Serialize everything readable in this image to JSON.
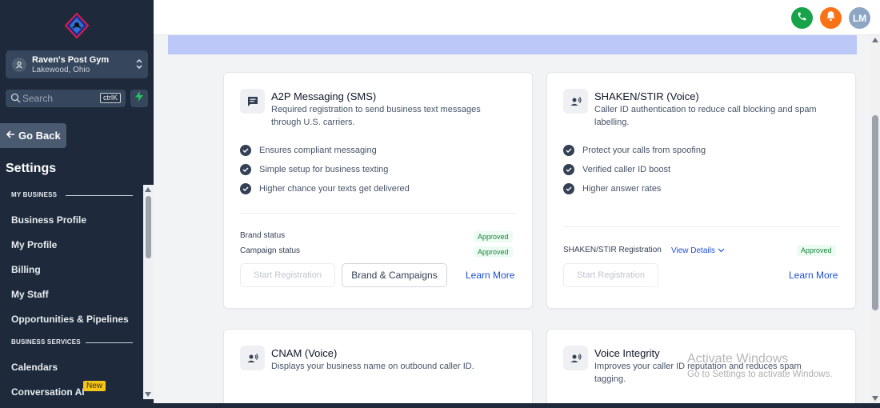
{
  "sidebar": {
    "location": {
      "name": "Raven's Post Gym",
      "sub": "Lakewood, Ohio"
    },
    "search": {
      "placeholder": "Search",
      "shortcut": "ctrlK"
    },
    "go_back": "Go Back",
    "settings_title": "Settings",
    "sections": [
      {
        "label": "MY BUSINESS"
      },
      {
        "label": "BUSINESS SERVICES"
      }
    ],
    "items": [
      {
        "label": "Business Profile"
      },
      {
        "label": "My Profile"
      },
      {
        "label": "Billing"
      },
      {
        "label": "My Staff"
      },
      {
        "label": "Opportunities & Pipelines"
      },
      {
        "label": "Calendars"
      },
      {
        "label": "Conversation AI",
        "badge": "New"
      }
    ]
  },
  "topbar": {
    "avatar_initials": "LM",
    "icons": [
      "phone-icon",
      "bell-icon"
    ]
  },
  "cards": [
    {
      "icon": "message-icon",
      "title": "A2P Messaging (SMS)",
      "description": "Required registration to send business text messages through U.S. carriers.",
      "features": [
        "Ensures compliant messaging",
        "Simple setup for business texting",
        "Higher chance your texts get delivered"
      ],
      "statuses": [
        {
          "label": "Brand status",
          "value": "Approved"
        },
        {
          "label": "Campaign status",
          "value": "Approved"
        }
      ],
      "buttons": {
        "start": "Start Registration",
        "secondary": "Brand & Campaigns",
        "learn": "Learn More"
      }
    },
    {
      "icon": "voice-icon",
      "title": "SHAKEN/STIR (Voice)",
      "description": "Caller ID authentication to reduce call blocking and spam labelling.",
      "features": [
        "Protect your calls from spoofing",
        "Verified caller ID boost",
        "Higher answer rates"
      ],
      "registration": {
        "label": "SHAKEN/STIR Registration",
        "view_details": "View Details",
        "value": "Approved"
      },
      "buttons": {
        "start": "Start Registration",
        "learn": "Learn More"
      }
    },
    {
      "icon": "voice-icon",
      "title": "CNAM (Voice)",
      "description": "Displays your business name on outbound caller ID."
    },
    {
      "icon": "voice-icon",
      "title": "Voice Integrity",
      "description": "Improves your caller ID reputation and reduces spam tagging."
    }
  ],
  "watermark": {
    "line1": "Activate Windows",
    "line2": "Go to Settings to activate Windows."
  },
  "colors": {
    "sidebar_bg": "#1e2a3b",
    "approved": "#16803c",
    "link": "#1d4ed8",
    "banner": "#bcc8f8"
  }
}
